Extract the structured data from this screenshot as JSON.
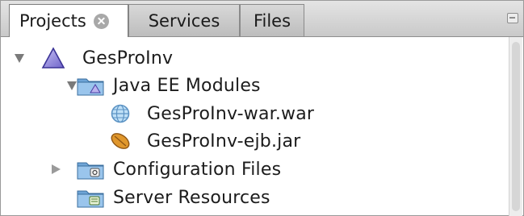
{
  "tabs": {
    "projects": "Projects",
    "services": "Services",
    "files": "Files"
  },
  "tree": {
    "root": "GesProInv",
    "java_ee_modules": "Java EE Modules",
    "war": "GesProInv-war.war",
    "ejb": "GesProInv-ejb.jar",
    "configuration_files": "Configuration Files",
    "server_resources": "Server Resources"
  }
}
